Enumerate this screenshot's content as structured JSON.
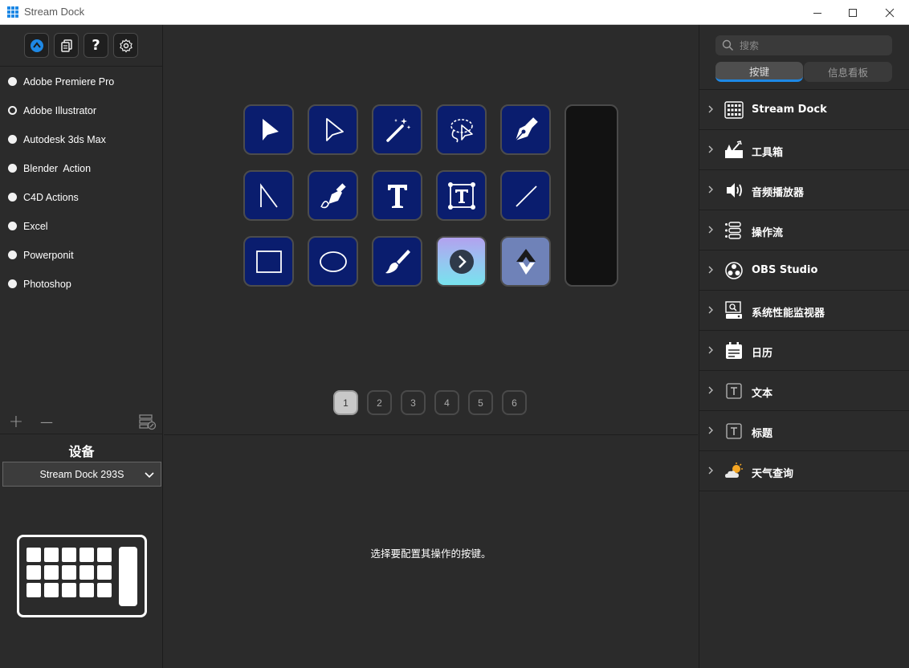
{
  "window": {
    "title": "Stream Dock"
  },
  "colors": {
    "accent": "#1e88e5",
    "key_bg": "#0a1d6e",
    "panel_bg": "#2b2b2b"
  },
  "toolbar": {
    "buttons": [
      {
        "icon": "store-icon"
      },
      {
        "icon": "copy-icon"
      },
      {
        "icon": "help-icon",
        "label": "?"
      },
      {
        "icon": "gear-icon"
      }
    ]
  },
  "profiles": [
    {
      "label": "Adobe Premiere Pro",
      "selected": false
    },
    {
      "label": "Adobe Illustrator",
      "selected": true
    },
    {
      "label": "Autodesk 3ds Max",
      "selected": false
    },
    {
      "label": "Blender  Action",
      "selected": false
    },
    {
      "label": "C4D Actions",
      "selected": false
    },
    {
      "label": "Excel",
      "selected": false
    },
    {
      "label": "Powerponit",
      "selected": false
    },
    {
      "label": "Photoshop",
      "selected": false
    }
  ],
  "left_actions": {
    "add": "+",
    "remove": "—"
  },
  "device": {
    "title": "设备",
    "selected": "Stream Dock 293S"
  },
  "keys": [
    {
      "icon": "selection-arrow-icon"
    },
    {
      "icon": "direct-selection-icon"
    },
    {
      "icon": "magic-wand-icon"
    },
    {
      "icon": "lasso-icon"
    },
    {
      "icon": "pen-tool-icon"
    },
    {
      "icon": "line-angle-icon"
    },
    {
      "icon": "curvature-pen-icon"
    },
    {
      "icon": "type-tool-icon"
    },
    {
      "icon": "area-type-icon"
    },
    {
      "icon": "line-segment-icon"
    },
    {
      "icon": "rectangle-icon"
    },
    {
      "icon": "ellipse-icon"
    },
    {
      "icon": "paintbrush-icon"
    },
    {
      "icon": "next-page-icon"
    },
    {
      "icon": "switch-profile-icon"
    }
  ],
  "pages": [
    "1",
    "2",
    "3",
    "4",
    "5",
    "6"
  ],
  "active_page": "1",
  "hint": "选择要配置其操作的按键。",
  "search": {
    "placeholder": "搜索"
  },
  "tabs": {
    "keys": "按键",
    "dashboard": "信息看板"
  },
  "categories": [
    {
      "label": "Stream Dock",
      "icon": "keypad-icon"
    },
    {
      "label": "工具箱",
      "icon": "toolbox-icon"
    },
    {
      "label": "音频播放器",
      "icon": "speaker-icon"
    },
    {
      "label": "操作流",
      "icon": "flow-icon"
    },
    {
      "label": "OBS Studio",
      "icon": "obs-icon"
    },
    {
      "label": "系统性能监视器",
      "icon": "monitor-icon"
    },
    {
      "label": "日历",
      "icon": "calendar-icon"
    },
    {
      "label": "文本",
      "icon": "text-icon"
    },
    {
      "label": "标题",
      "icon": "title-icon"
    },
    {
      "label": "天气查询",
      "icon": "weather-icon"
    }
  ]
}
